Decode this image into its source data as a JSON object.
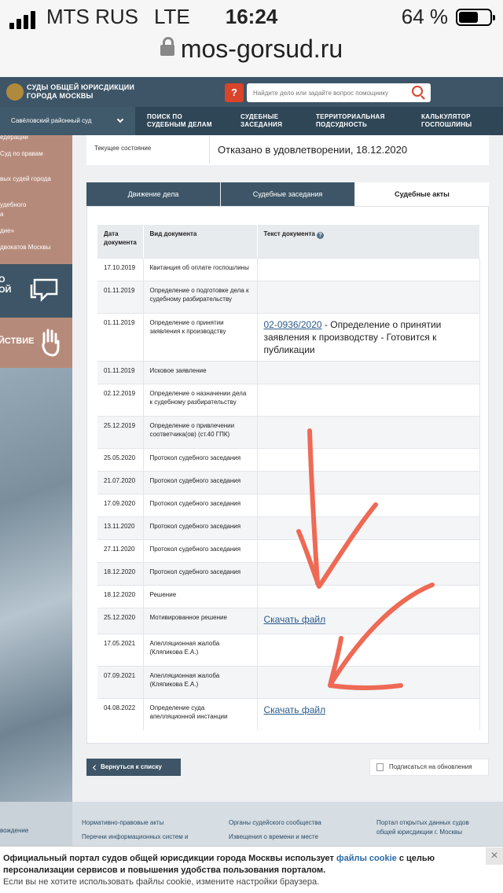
{
  "status_bar": {
    "carrier": "MTS RUS",
    "network": "LTE",
    "time": "16:24",
    "battery": "64 %",
    "battery_level": 0.64
  },
  "browser": {
    "url": "mos-gorsud.ru"
  },
  "header": {
    "site_name_line1": "СУДЫ ОБЩЕЙ ЮРИСДИКЦИИ",
    "site_name_line2": "ГОРОДА МОСКВЫ",
    "help_label": "?",
    "search_placeholder": "Найдите дело или задайте вопрос помощнику"
  },
  "nav": {
    "court": "Савёловский районный суд",
    "items": [
      {
        "l1": "ПОИСК ПО",
        "l2": "СУДЕБНЫМ ДЕЛАМ"
      },
      {
        "l1": "СУДЕБНЫЕ",
        "l2": "ЗАСЕДАНИЯ"
      },
      {
        "l1": "ТЕРРИТОРИАЛЬНАЯ",
        "l2": "ПОДСУДНОСТЬ"
      },
      {
        "l1": "КАЛЬКУЛЯТОР",
        "l2": "ГОСПОШЛИНЫ"
      }
    ]
  },
  "sidebar": {
    "links": [
      "едерации",
      "Суд по правам",
      "вых судей города",
      "удебного",
      "а",
      "дие»",
      "двокатов Москвы"
    ],
    "block1_text": [
      "О",
      "ОЙ"
    ],
    "block2_text": "ЙСТВИЕ"
  },
  "case": {
    "state_label": "Текущее состояние",
    "state_value": "Отказано в удовлетворении, 18.12.2020"
  },
  "tabs": [
    "Движение дела",
    "Судебные заседания",
    "Судебные акты"
  ],
  "table": {
    "headers": {
      "date_l1": "Дата",
      "date_l2": "документа",
      "type": "Вид документа",
      "text": "Текст документа",
      "text_help": "?"
    },
    "rows": [
      {
        "date": "17.10.2019",
        "type": "Квитанция об оплате госпошлины",
        "text": ""
      },
      {
        "date": "01.11.2019",
        "type": "Определение о подготовке дела к судебному разбирательству",
        "text": ""
      },
      {
        "date": "01.11.2019",
        "type": "Определение о принятии заявления к производству",
        "link": "02-0936/2020",
        "text": " - Определение о принятии заявления к производству - Готовится к публикации"
      },
      {
        "date": "01.11.2019",
        "type": "Исковое заявление",
        "text": ""
      },
      {
        "date": "02.12.2019",
        "type": "Определение о назначении дела к судебному разбирательству",
        "text": ""
      },
      {
        "date": "25.12.2019",
        "type": "Определение о привлечении соответчика(ов) (ст.40 ГПК)",
        "text": ""
      },
      {
        "date": "25.05.2020",
        "type": "Протокол судебного заседания",
        "text": ""
      },
      {
        "date": "21.07.2020",
        "type": "Протокол судебного заседания",
        "text": ""
      },
      {
        "date": "17.09.2020",
        "type": "Протокол судебного заседания",
        "text": ""
      },
      {
        "date": "13.11.2020",
        "type": "Протокол судебного заседания",
        "text": ""
      },
      {
        "date": "27.11.2020",
        "type": "Протокол судебного заседания",
        "text": ""
      },
      {
        "date": "18.12.2020",
        "type": "Протокол судебного заседания",
        "text": ""
      },
      {
        "date": "18.12.2020",
        "type": "Решение",
        "text": ""
      },
      {
        "date": "25.12.2020",
        "type": "Мотивированное решение",
        "link": "Скачать файл",
        "text": ""
      },
      {
        "date": "17.05.2021",
        "type": "Апелляционная жалоба (Кляпикова Е.А.)",
        "text": ""
      },
      {
        "date": "07.09.2021",
        "type": "Апелляционная жалоба (Кляпикова Е.А.)",
        "text": ""
      },
      {
        "date": "04.08.2022",
        "type": "Определение суда апелляционной инстанции",
        "link": "Скачать файл",
        "text": ""
      }
    ]
  },
  "actions": {
    "back": "Вернуться к списку",
    "subscribe": "Подписаться на обновления"
  },
  "footer": {
    "left": "вождение",
    "col1": [
      "Нормативно-правовые акты",
      "Перечни информационных систем и"
    ],
    "col2": [
      "Органы судейского сообщества",
      "Извещения о времени и месте"
    ],
    "col3": [
      "Портал открытых данных судов",
      "общей юрисдикции г. Москвы"
    ]
  },
  "cookie": {
    "line1_a": "Официальный портал судов общей юрисдикции города Москвы использует ",
    "line1_link": "файлы cookie",
    "line1_b": " с целью",
    "line2": "персонализации сервисов и повышения удобства пользования порталом.",
    "line3": "Если вы не хотите использовать файлы cookie, измените настройки браузера.",
    "close": "×"
  },
  "colors": {
    "header": "#3d5566",
    "accent": "#d9442b",
    "annotation": "#ee6a55"
  }
}
